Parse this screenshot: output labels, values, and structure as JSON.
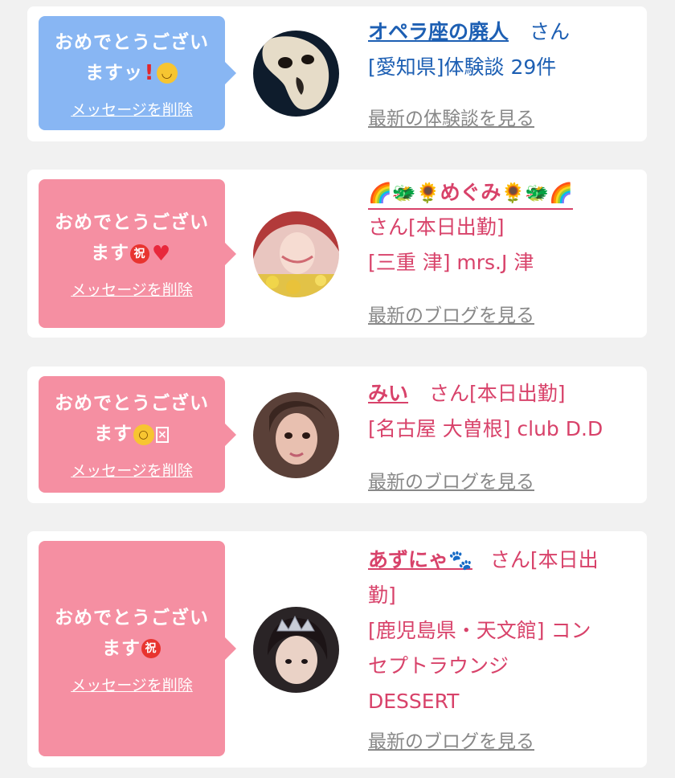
{
  "cards": [
    {
      "message": "おめでとうございますッ",
      "message_line1": "おめでとうござい",
      "message_line2": "ますッ",
      "delete_label": "メッセージを削除",
      "name": "オペラ座の廃人",
      "honorific": "さん",
      "detail": "[愛知県]体験談 29件",
      "see_label": "最新の体験談を見る",
      "bubble_color": "#88b6f3"
    },
    {
      "message_line1": "おめでとうござい",
      "message_line2": "ます",
      "delete_label": "メッセージを削除",
      "name": "めぐみ",
      "honorific_line": "さん[本日出勤]",
      "detail": "[三重 津] mrs.J 津",
      "see_label": "最新のブログを見る",
      "bubble_color": "#f58fa2"
    },
    {
      "message_line1": "おめでとうござい",
      "message_line2": "ます",
      "delete_label": "メッセージを削除",
      "name": "みい",
      "honorific_line": "さん[本日出勤]",
      "detail": "[名古屋 大曽根] club D.D",
      "see_label": "最新のブログを見る",
      "bubble_color": "#f58fa2"
    },
    {
      "message_line1": "おめでとうござい",
      "message_line2": "ます",
      "delete_label": "メッセージを削除",
      "name": "あずにゃ",
      "honorific_line1": "さん[本日出",
      "honorific_line2": "勤]",
      "detail_line1": "[鹿児島県・天文館] コン",
      "detail_line2": "セプトラウンジ",
      "detail_line3": "DESSERT",
      "see_label": "最新のブログを見る",
      "bubble_color": "#f58fa2"
    }
  ],
  "icons": {
    "emoji_smile": "smiling-face-emoji",
    "emoji_exclamation": "red-exclamation-emoji",
    "emoji_celebrate": "celebration-kanji-emoji",
    "emoji_heart": "red-heart-emoji",
    "emoji_flushed": "flushed-face-emoji",
    "emoji_missing": "missing-glyph-box",
    "deco_rainbow": "rainbow-emoji",
    "deco_dragon": "dragon-emoji",
    "deco_sunflower": "sunflower-emoji",
    "deco_paw": "paw-prints-emoji"
  },
  "emoji_text": {
    "smile": "☺",
    "exclamation": "❗",
    "celebrate": "祝",
    "heart": "♥",
    "flushed": "😳",
    "rainbow": "🌈",
    "dragon": "🐲",
    "sunflower": "🌻",
    "paw": "🐾"
  }
}
